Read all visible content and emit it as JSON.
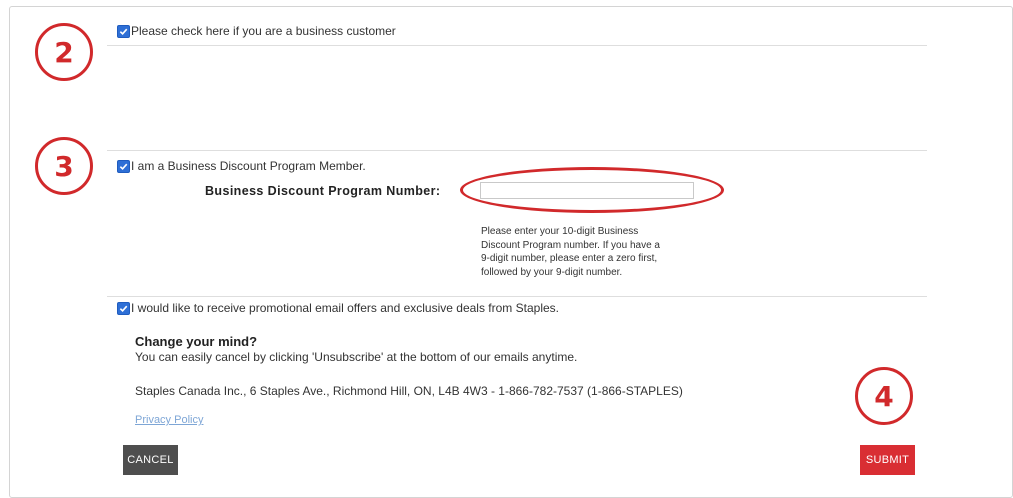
{
  "business_customer": {
    "checked": true,
    "label": "Please check here if you are a business customer"
  },
  "discount_program": {
    "checked": true,
    "label": "I am a Business Discount Program Member.",
    "number_label": "Business Discount Program Number:",
    "number_value": "",
    "help_lines": [
      "Please enter your 10-digit Business",
      "Discount Program number. If you have a",
      "9-digit number, please enter a zero first,",
      "followed by your 9-digit number."
    ]
  },
  "promo_email": {
    "checked": true,
    "label": "I would like to receive promotional email offers and exclusive deals from Staples."
  },
  "change_mind": {
    "heading": "Change your mind?",
    "body": "You can easily cancel by clicking 'Unsubscribe' at the bottom of our emails anytime."
  },
  "company_address": "Staples Canada Inc., 6 Staples Ave., Richmond Hill, ON, L4B 4W3 - 1-866-782-7537 (1-866-STAPLES)",
  "privacy_link": "Privacy Policy",
  "buttons": {
    "cancel": "CANCEL",
    "submit": "SUBMIT"
  },
  "annotations": {
    "step2": "2",
    "step3": "3",
    "step4": "4"
  },
  "colors": {
    "accent_red": "#d92e33",
    "checkbox_blue": "#2e6fd6",
    "cancel_gray": "#4e4e4e",
    "link_blue": "#7ea6d6"
  }
}
